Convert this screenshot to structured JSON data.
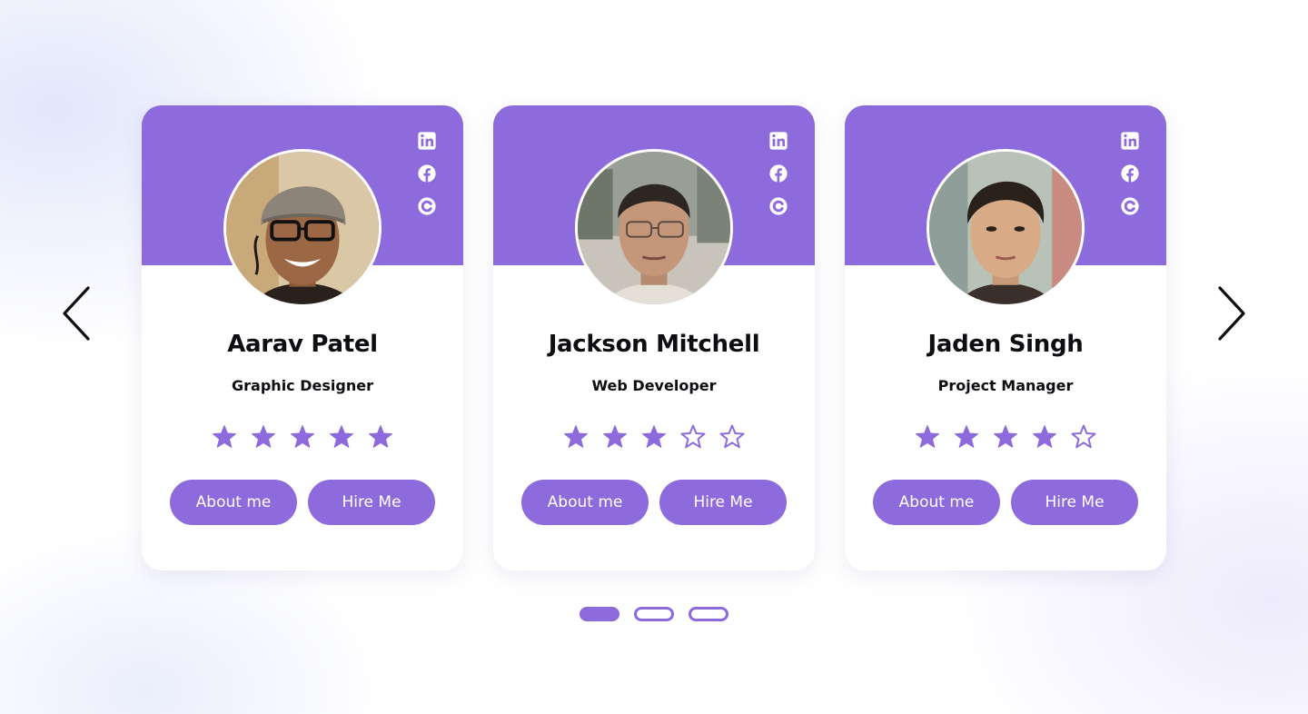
{
  "colors": {
    "accent": "#8e6bdc",
    "text": "#0d0d12",
    "background": "#ffffff",
    "icon": "#ffffff"
  },
  "carousel": {
    "prev_icon": "chevron-left-icon",
    "next_icon": "chevron-right-icon",
    "active_page": 1,
    "page_count": 3
  },
  "cards": [
    {
      "name": "Aarav Patel",
      "role": "Graphic Designer",
      "rating": 5,
      "rating_max": 5,
      "about_label": "About me",
      "hire_label": "Hire Me",
      "social_icons": [
        "linkedin-icon",
        "facebook-icon",
        "c-logo-icon"
      ]
    },
    {
      "name": "Jackson Mitchell",
      "role": "Web Developer",
      "rating": 3,
      "rating_max": 5,
      "about_label": "About me",
      "hire_label": "Hire Me",
      "social_icons": [
        "linkedin-icon",
        "facebook-icon",
        "c-logo-icon"
      ]
    },
    {
      "name": "Jaden Singh",
      "role": "Project Manager",
      "rating": 4,
      "rating_max": 5,
      "about_label": "About me",
      "hire_label": "Hire Me",
      "social_icons": [
        "linkedin-icon",
        "facebook-icon",
        "c-logo-icon"
      ]
    }
  ]
}
